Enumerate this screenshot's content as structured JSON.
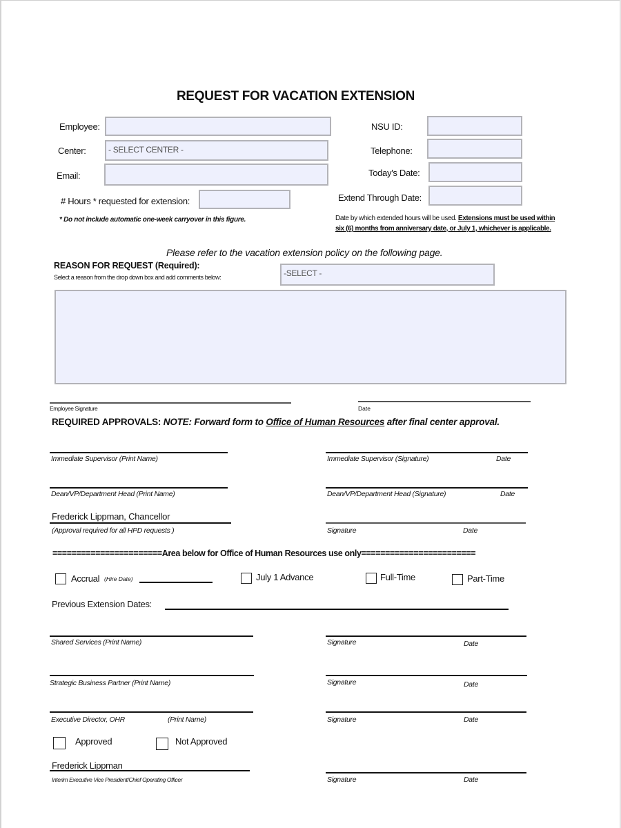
{
  "form": {
    "title": "REQUEST FOR VACATION EXTENSION",
    "employee_label": "Employee:",
    "employee_value": "",
    "center_label": "Center:",
    "center_value": "- SELECT CENTER -",
    "email_label": "Email:",
    "email_value": "",
    "hours_label": "# Hours * requested for extension:",
    "hours_value": "",
    "hours_note": "* Do not include automatic one-week carryover in this figure.",
    "nsu_id_label": "NSU ID:",
    "nsu_id_value": "",
    "telephone_label": "Telephone:",
    "telephone_value": "",
    "todays_date_label": "Today's Date:",
    "todays_date_value": "",
    "extend_through_label": "Extend Through Date:",
    "extend_through_value": "",
    "extend_note_plain": "Date by which extended hours will be used. ",
    "extend_note_bold": "Extensions must be used within six (6) months from anniversary date, or July 1, whichever is applicable.",
    "policy_note": "Please refer to the vacation extension policy on the following page.",
    "reason_heading": "REASON FOR REQUEST (Required):",
    "reason_instructions": "Select a reason from the drop down box and add comments below:",
    "reason_select_value": "-SELECT -",
    "comments_value": "",
    "employee_signature_caption": "Employee Signature",
    "employee_date_caption": "Date"
  },
  "approvals": {
    "heading_bold": "REQUIRED APPROVALS:",
    "note_prefix": "NOTE:  Forward form to ",
    "note_link": "Office of Human Resources",
    "note_suffix": " after final center approval.",
    "supervisor_print": "Immediate Supervisor (Print Name)",
    "supervisor_sig": "Immediate Supervisor (Signature)",
    "dean_print": "Dean/VP/Department Head (Print Name)",
    "dean_sig": "Dean/VP/Department Head (Signature)",
    "chancellor_name": "Frederick Lippman, Chancellor",
    "chancellor_note": "(Approval required for all HPD requests )",
    "signature": "Signature",
    "date": "Date"
  },
  "hr_area": {
    "separator": "=======================Area below for Office of Human Resources use only========================",
    "accrual_label": "Accrual",
    "accrual_hint": "(Hire Date)",
    "july_advance_label": "July 1 Advance",
    "full_time_label": "Full-Time",
    "part_time_label": "Part-Time",
    "previous_dates_label": "Previous Extension Dates:",
    "shared_services": "Shared Services (Print Name)",
    "strategic_partner": "Strategic Business Partner (Print Name)",
    "exec_director": "Executive Director, OHR",
    "print_name": "(Print Name)",
    "approved_label": "Approved",
    "not_approved_label": "Not Approved",
    "evp_name": "Frederick Lippman",
    "evp_title": "Interim Executive Vice President/Chief Operating Officer",
    "signature": "Signature",
    "date": "Date"
  }
}
